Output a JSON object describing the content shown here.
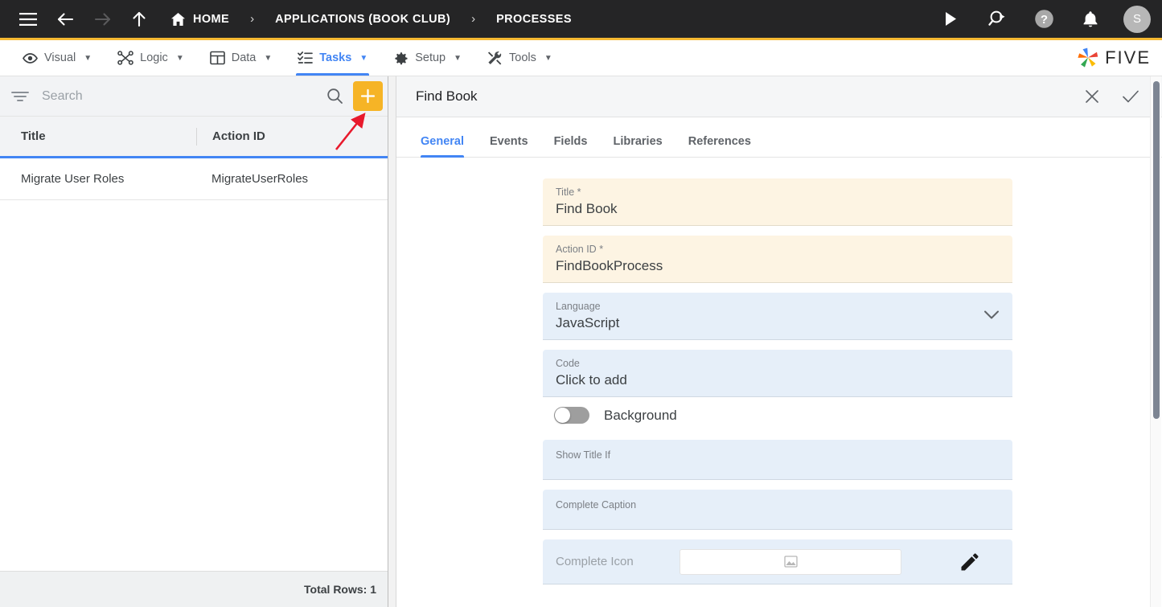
{
  "topbar": {
    "menu_icon": "hamburger-icon",
    "back_icon": "arrow-left-icon",
    "forward_icon": "arrow-right-icon",
    "up_icon": "arrow-up-icon",
    "home_label": "HOME",
    "separator": "›",
    "breadcrumb_app": "APPLICATIONS (BOOK CLUB)",
    "breadcrumb_section": "PROCESSES",
    "run_icon": "play-icon",
    "preview_icon": "search-run-icon",
    "help_icon": "help-circle-icon",
    "notifications_icon": "bell-icon",
    "avatar_initial": "S",
    "accent_color": "#f5b932",
    "background_color": "#252526"
  },
  "menubar": {
    "items": [
      {
        "label": "Visual",
        "icon": "eye-icon",
        "caret": "▼",
        "active": false
      },
      {
        "label": "Logic",
        "icon": "nodes-icon",
        "caret": "▼",
        "active": false
      },
      {
        "label": "Data",
        "icon": "table-grid-icon",
        "caret": "▼",
        "active": false
      },
      {
        "label": "Tasks",
        "icon": "checklist-icon",
        "caret": "▼",
        "active": true
      },
      {
        "label": "Setup",
        "icon": "gear-icon",
        "caret": "▼",
        "active": false
      },
      {
        "label": "Tools",
        "icon": "wrench-screwdriver-icon",
        "caret": "▼",
        "active": false
      }
    ],
    "logo_text": "FIVE",
    "active_color": "#4285f4"
  },
  "left_panel": {
    "search": {
      "filter_icon": "filter-icon",
      "placeholder": "Search",
      "value": "",
      "search_icon": "search-icon",
      "add_label": "+",
      "add_icon": "plus-icon",
      "add_color": "#f6b426"
    },
    "table": {
      "columns": [
        "Title",
        "Action ID"
      ],
      "rows": [
        {
          "title": "Migrate User Roles",
          "action_id": "MigrateUserRoles"
        }
      ],
      "header_underline_color": "#4285f4"
    },
    "footer": {
      "total_rows_label": "Total Rows: 1"
    }
  },
  "right_panel": {
    "title": "Find Book",
    "close_icon": "close-icon",
    "confirm_icon": "check-icon",
    "tabs": [
      {
        "label": "General",
        "active": true
      },
      {
        "label": "Events",
        "active": false
      },
      {
        "label": "Fields",
        "active": false
      },
      {
        "label": "Libraries",
        "active": false
      },
      {
        "label": "References",
        "active": false
      }
    ],
    "form": {
      "title_field": {
        "label": "Title",
        "required_mark": "*",
        "value": "Find Book"
      },
      "action_id_field": {
        "label": "Action ID",
        "required_mark": "*",
        "value": "FindBookProcess"
      },
      "language_field": {
        "label": "Language",
        "value": "JavaScript",
        "chevron": "chevron-down-icon"
      },
      "code_field": {
        "label": "Code",
        "value": "Click to add"
      },
      "background_toggle": {
        "label": "Background",
        "state": "off"
      },
      "show_title_if_field": {
        "label": "Show Title If",
        "value": ""
      },
      "complete_caption_field": {
        "label": "Complete Caption",
        "value": ""
      },
      "complete_icon_field": {
        "label": "Complete Icon",
        "image_placeholder_icon": "image-icon",
        "edit_icon": "pencil-icon"
      }
    },
    "required_field_color": "#fdf4e3",
    "optional_field_color": "#e6eff9"
  },
  "annotation": {
    "arrow_color": "#e8192c",
    "points_to": "add-button"
  }
}
